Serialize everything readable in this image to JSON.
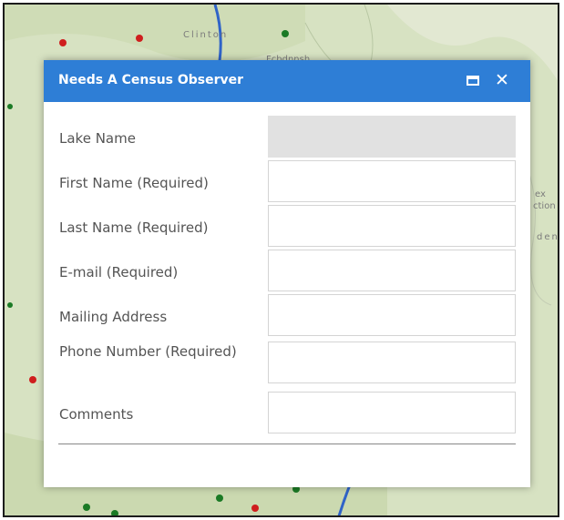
{
  "map": {
    "place_labels": [
      "Clinton",
      "Fcbdnnsh",
      "ex",
      "ction",
      "den"
    ]
  },
  "popup": {
    "title": "Needs A Census Observer",
    "maximize_icon": "maximize-icon",
    "close_symbol": "✕",
    "colors": {
      "header": "#2e7ed6",
      "title_text": "#ffffff"
    }
  },
  "form": {
    "fields": [
      {
        "label": "Lake Name",
        "value": "",
        "disabled": true
      },
      {
        "label": "First Name (Required)",
        "value": ""
      },
      {
        "label": "Last Name (Required)",
        "value": ""
      },
      {
        "label": "E-mail (Required)",
        "value": ""
      },
      {
        "label": "Mailing Address",
        "value": ""
      },
      {
        "label": "Phone Number (Required)",
        "value": ""
      },
      {
        "label": "Comments",
        "value": ""
      }
    ]
  }
}
